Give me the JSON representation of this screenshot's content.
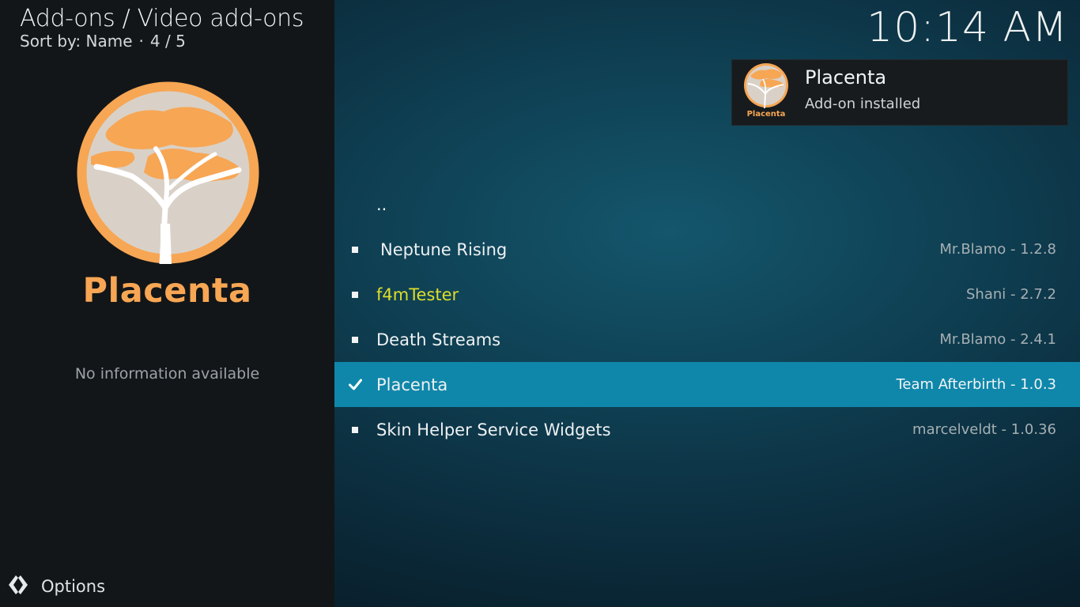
{
  "header": {
    "breadcrumb": "Add-ons / Video add-ons",
    "sort_label": "Sort by: Name",
    "separator": "·",
    "position": "4 / 5",
    "clock": "10:14 AM"
  },
  "info_panel": {
    "addon_name": "Placenta",
    "description": "No information available",
    "logo_icon": "acacia-tree-logo-icon",
    "accent_color": "#f7a654"
  },
  "notification": {
    "icon": "placenta-logo-icon",
    "icon_caption": "Placenta",
    "title": "Placenta",
    "message": "Add-on installed"
  },
  "list": {
    "parent_label": "..",
    "items": [
      {
        "name": "Neptune Rising",
        "meta": "Mr.Blamo - 1.2.8",
        "state": "bullet"
      },
      {
        "name": "f4mTester",
        "meta": "Shani - 2.7.2",
        "state": "bullet",
        "highlight_color": "#dede2a"
      },
      {
        "name": "Death Streams",
        "meta": "Mr.Blamo - 2.4.1",
        "state": "bullet"
      },
      {
        "name": "Placenta",
        "meta": "Team Afterbirth - 1.0.3",
        "state": "check",
        "selected": true
      },
      {
        "name": "Skin Helper Service Widgets",
        "meta": "marcelveldt - 1.0.36",
        "state": "bullet"
      }
    ]
  },
  "footer": {
    "options_label": "Options",
    "options_icon": "options-arrow-icon"
  },
  "colors": {
    "selection": "#0f87aa",
    "left_panel_bg": "#131618"
  }
}
